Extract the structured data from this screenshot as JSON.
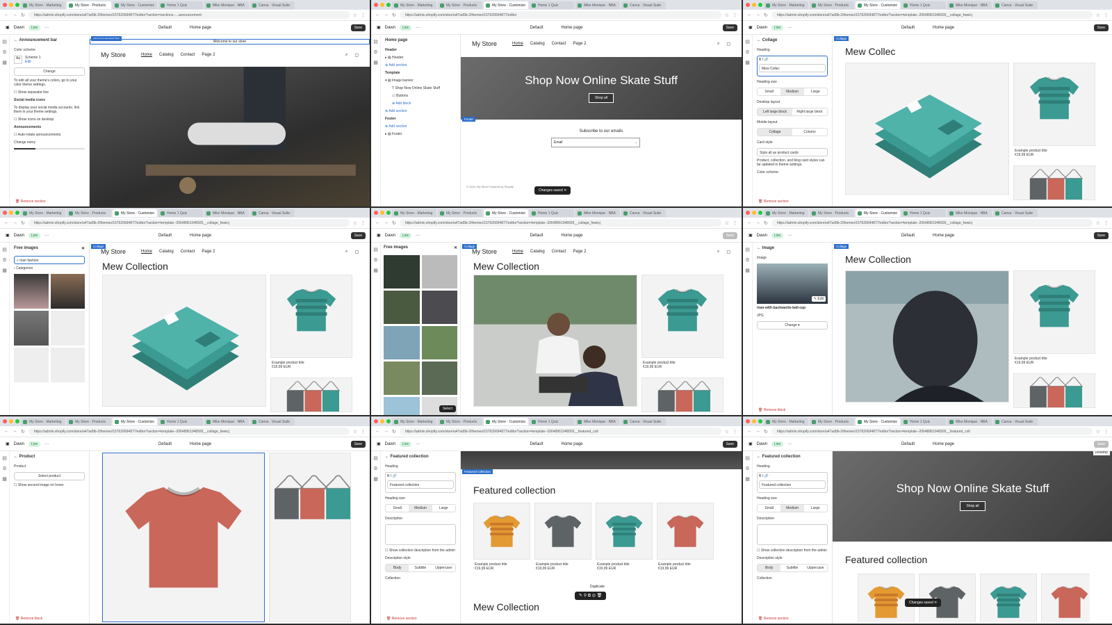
{
  "colors": {
    "teal": "#3b9a92",
    "teal_dark": "#2f7f78",
    "red": "#c9675a",
    "orange": "#e39a32",
    "grey": "#5e6466",
    "accent": "#2c6ecb"
  },
  "tabs": [
    "My Store · Marketing",
    "My Store · Products",
    "My Store · Customize",
    "Home 1 Quiz",
    "Mike Monique · NBA",
    "Canva · Visual Suite"
  ],
  "app": {
    "store": "Dawn",
    "live": "Live",
    "theme": "Default",
    "page": "Home page",
    "save": "Save"
  },
  "urls": [
    "https://admin.shopify.com/store/a47ad9b-2/themes/157626694877/editor?section=sections--...announcement",
    "https://admin.shopify.com/store/a47ad9b-2/themes/157626694877/editor",
    "https://admin.shopify.com/store/a47ad9b-2/themes/157626694877/editor?section=template--20648961048926__collage_fwwicj",
    "https://admin.shopify.com/store/a47ad9b-2/themes/157626694877/editor?section=template--20648961048926__collage_fwwicj",
    "https://admin.shopify.com/store/a47ad9b-2/themes/157626694877/editor?section=template--20648961048926__collage_fwwicj",
    "https://admin.shopify.com/store/a47ad9b-2/themes/157626694877/editor?section=template--20648961048926__collage_fwwicj",
    "https://admin.shopify.com/store/a47ad9b-2/themes/157626694877/editor?section=template--20648961048926__collage_fwwicj",
    "https://admin.shopify.com/store/a47ad9b-2/themes/157626694877/editor?section=template--20648961048926__featured_coll",
    "https://admin.shopify.com/store/a47ad9b-2/themes/157626694877/editor?section=template--20648961048926__featured_coll"
  ],
  "store": {
    "name": "My Store",
    "nav": [
      "Home",
      "Catalog",
      "Contact",
      "Page 2"
    ]
  },
  "p1": {
    "panel_title": "Announcement bar",
    "color_scheme": "Color scheme",
    "scheme": "Scheme 1",
    "edit": "Edit",
    "change": "Change",
    "note": "To edit all your theme's colors, go to your color theme settings.",
    "sep": "Show separator line",
    "social": "Social media icons",
    "social_note": "To display your social media accounts, link them in your theme settings.",
    "icons": "Show icons on desktop",
    "ann": "Announcements",
    "auto": "Auto-rotate announcements",
    "every": "Change every",
    "remove": "Remove section",
    "tag": "Announcement bar",
    "welcome": "Welcome to our store"
  },
  "p2": {
    "panel_title": "Home page",
    "header": "Header",
    "header_item": "Header",
    "add_section": "Add section",
    "template": "Template",
    "image_banner": "Image banner",
    "banner_text": "Shop Now Online Skate Stuff",
    "buttons": "Buttons",
    "add_block": "Add block",
    "footer": "Footer",
    "footer_item": "Footer",
    "hero": "Shop Now Online Skate Stuff",
    "shop_all": "Shop all",
    "tag": "Footer",
    "subscribe": "Subscribe to our emails",
    "email": "Email",
    "copyright": "© 2024, My Store Powered by Shopify",
    "toast": "Changes saved"
  },
  "p3": {
    "panel_title": "Collage",
    "heading": "Heading",
    "heading_val": "Mew Collec",
    "size": "Heading size",
    "sizes": [
      "Small",
      "Medium",
      "Large"
    ],
    "desktop": "Desktop layout",
    "desktop_opts": [
      "Left large block",
      "Right large block"
    ],
    "mobile": "Mobile layout",
    "mobile_opts": [
      "Collage",
      "Column"
    ],
    "card": "Card style",
    "card_val": "Style all as product cards",
    "card_note": "Product, collection, and blog card styles can be updated in theme settings.",
    "scheme": "Color scheme",
    "remove": "Remove section",
    "title": "Mew Collec",
    "prod_title": "Example product title",
    "price": "€19,99 EUR",
    "tag": "Collage"
  },
  "p4": {
    "panel_title": "Free images",
    "search": "man fashion",
    "categories": "Categories",
    "title": "Mew Collection",
    "prod_title": "Example product title",
    "price": "€19,99 EUR",
    "tag": "Collage"
  },
  "p5": {
    "panel_title": "Free images",
    "select": "Select",
    "title": "Mew Collection",
    "prod_title": "Example product title",
    "price": "€19,99 EUR",
    "tag": "Collage"
  },
  "p6": {
    "panel_title": "Image",
    "image": "Image",
    "edit": "Edit",
    "file": "man-with-backwards-ball-cap",
    "type": "JPG",
    "change": "Change",
    "remove": "Remove block",
    "title": "Mew Collection",
    "prod_title": "Example product title",
    "price": "€19,99 EUR",
    "tag": "Collage"
  },
  "p7": {
    "panel_title": "Product",
    "product": "Product",
    "select": "Select product",
    "second": "Show second image on hover",
    "remove": "Remove block"
  },
  "p8": {
    "panel_title": "Featured collection",
    "heading": "Heading",
    "heading_val": "Featured collection",
    "size": "Heading size",
    "sizes": [
      "Small",
      "Medium",
      "Large"
    ],
    "desc": "Description",
    "show_desc": "Show collection description from the admin",
    "desc_style": "Description style",
    "styles": [
      "Body",
      "Subtitle",
      "Uppercase"
    ],
    "collection": "Collection",
    "remove": "Remove section",
    "tag": "Featured collection",
    "title": "Featured collection",
    "prod_title": "Example product title",
    "price": "€19,99 EUR",
    "duplicate": "Duplicate",
    "mew": "Mew Collection"
  },
  "p9": {
    "panel_title": "Featured collection",
    "heading": "Heading",
    "heading_val": "Featured collection",
    "size": "Heading size",
    "sizes": [
      "Small",
      "Medium",
      "Large"
    ],
    "desc": "Description",
    "show_desc": "Show collection description from the admin",
    "desc_style": "Description style",
    "styles": [
      "Body",
      "Subtitle",
      "Uppercase"
    ],
    "collection": "Collection",
    "remove": "Remove section",
    "hero": "Shop Now Online Skate Stuff",
    "shop_all": "Shop all",
    "title": "Featured collection",
    "toast": "Changes saved",
    "desktop": "Desktop"
  }
}
